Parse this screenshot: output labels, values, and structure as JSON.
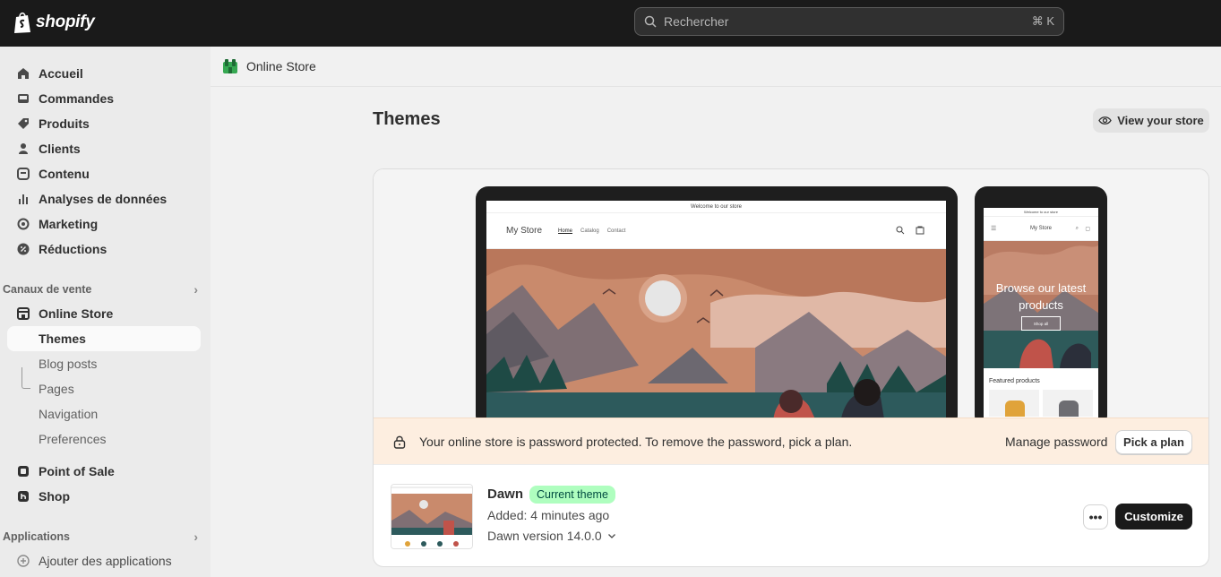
{
  "topbar": {
    "brand": "shopify",
    "search_placeholder": "Rechercher",
    "search_shortcut": "⌘ K"
  },
  "sidebar": {
    "items": [
      {
        "label": "Accueil",
        "icon": "home-icon"
      },
      {
        "label": "Commandes",
        "icon": "inbox-icon"
      },
      {
        "label": "Produits",
        "icon": "tag-icon"
      },
      {
        "label": "Clients",
        "icon": "person-icon"
      },
      {
        "label": "Contenu",
        "icon": "content-icon"
      },
      {
        "label": "Analyses de données",
        "icon": "bar-chart-icon"
      },
      {
        "label": "Marketing",
        "icon": "target-icon"
      },
      {
        "label": "Réductions",
        "icon": "discount-icon"
      }
    ],
    "sales_channels_label": "Canaux de vente",
    "online_store": {
      "label": "Online Store",
      "sub": [
        "Themes",
        "Blog posts",
        "Pages",
        "Navigation",
        "Preferences"
      ]
    },
    "point_of_sale": "Point of Sale",
    "shop": "Shop",
    "applications_label": "Applications",
    "add_apps": "Ajouter des applications"
  },
  "breadcrumb": {
    "title": "Online Store"
  },
  "page": {
    "title": "Themes",
    "view_store": "View your store"
  },
  "preview": {
    "announcement": "Welcome to our store",
    "store_name": "My Store",
    "nav": [
      "Home",
      "Catalog",
      "Contact"
    ],
    "mobile_hero": "Browse our latest products",
    "mobile_shop_all": "Shop all",
    "mobile_featured": "Featured products"
  },
  "banner": {
    "text": "Your online store is password protected. To remove the password, pick a plan.",
    "manage_password": "Manage password",
    "pick_plan": "Pick a plan"
  },
  "theme": {
    "name": "Dawn",
    "badge": "Current theme",
    "added": "Added: 4 minutes ago",
    "version": "Dawn version 14.0.0",
    "customize": "Customize",
    "more": "•••"
  },
  "colors": {
    "topbar": "#1a1a1a",
    "badge_bg": "#affebf",
    "banner_bg": "#fdeee0",
    "hero_sky": "#c8866a"
  }
}
